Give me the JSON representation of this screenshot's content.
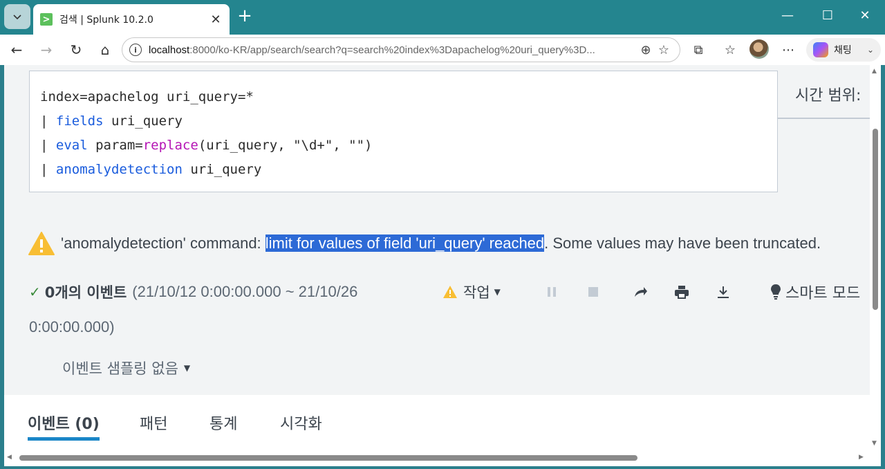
{
  "browser": {
    "tab_title": "검색 | Splunk 10.2.0",
    "favicon_glyph": ">",
    "url_host": "localhost",
    "url_rest": ":8000/ko-KR/app/search/search?q=search%20index%3Dapachelog%20uri_query%3D...",
    "copilot_label": "채팅"
  },
  "search": {
    "line1": "index=apachelog uri_query=*",
    "line2_pipe": "| ",
    "line2_kw": "fields",
    "line2_rest": " uri_query",
    "line3_pipe": "| ",
    "line3_kw": "eval",
    "line3_mid": " param=",
    "line3_fn": "replace",
    "line3_rest": "(uri_query, \"\\d+\", \"\")",
    "line4_pipe": "| ",
    "line4_kw": "anomalydetection",
    "line4_rest": " uri_query"
  },
  "time_range_label": "시간 범위:",
  "warning": {
    "prefix": "'anomalydetection' command: ",
    "highlighted": "limit for values of field 'uri_query' reached",
    "suffix": ". Some values may have been truncated."
  },
  "events": {
    "count_label": "0개의 이벤트",
    "range_line1": "(21/10/12 0:00:00.000 ~ 21/10/26",
    "range_line2": "0:00:00.000)"
  },
  "job_label": "작업",
  "smart_mode_label": "스마트 모드",
  "sampling_label": "이벤트 샘플링 없음",
  "tabs": [
    {
      "label": "이벤트 (0)"
    },
    {
      "label": "패턴"
    },
    {
      "label": "통계"
    },
    {
      "label": "시각화"
    }
  ],
  "colors": {
    "accent": "#1a86c7",
    "keyword": "#1a5cdd",
    "function": "#b515b5",
    "highlight": "#2d6ad6",
    "warning": "#f8be34"
  }
}
